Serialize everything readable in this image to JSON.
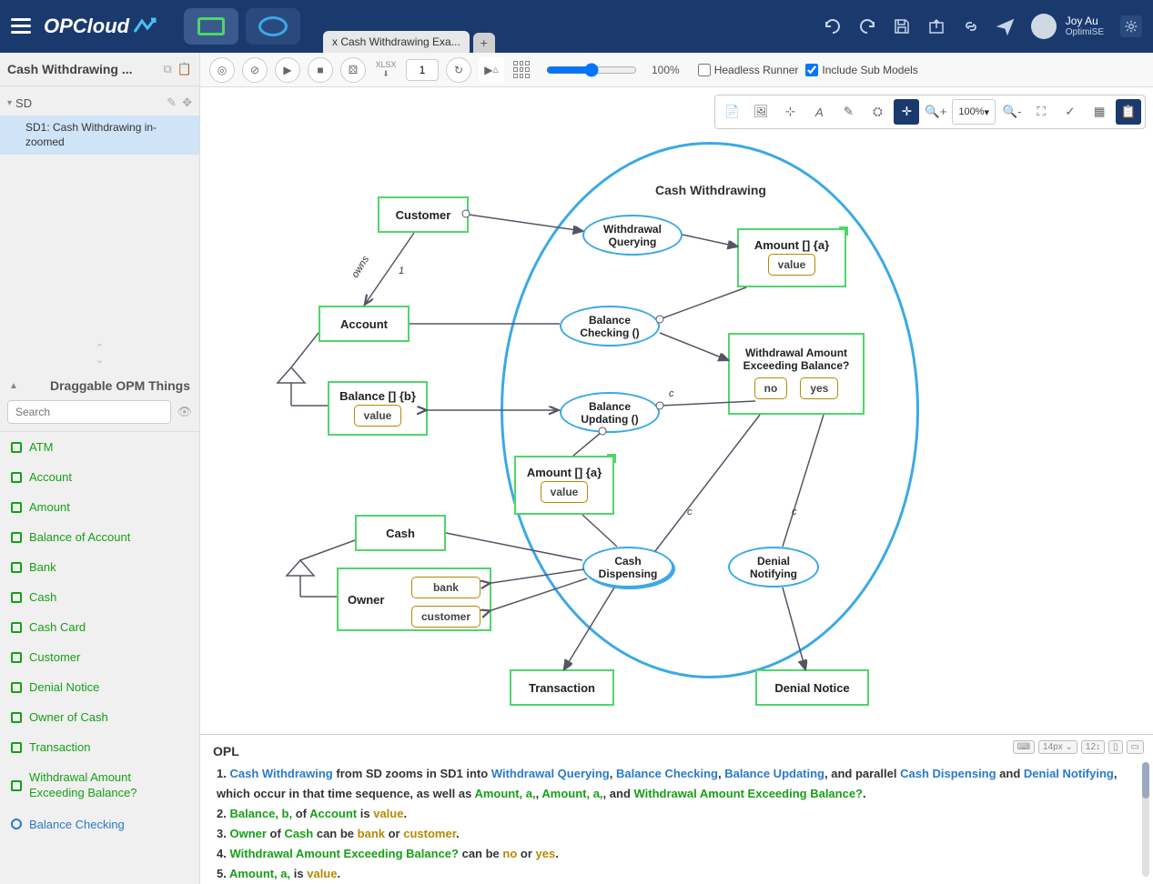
{
  "app": {
    "name": "OPCloud"
  },
  "user": {
    "name": "Joy Au",
    "org": "OptimiSE"
  },
  "shapes": {
    "rect": "object-shape",
    "oval": "process-shape"
  },
  "tab": {
    "label": "x Cash Withdrawing Exa..."
  },
  "toolbar": {
    "xlsx": "XLSX",
    "step": "1",
    "zoom": "100%",
    "headless": "Headless Runner",
    "include": "Include Sub Models"
  },
  "float_toolbar": {
    "zoom": "100%"
  },
  "sidebar": {
    "title": "Cash Withdrawing ...",
    "root": "SD",
    "child": "SD1: Cash Withdrawing in-zoomed",
    "drag_title": "Draggable OPM Things",
    "search_ph": "Search",
    "things": [
      {
        "label": "ATM",
        "type": "obj"
      },
      {
        "label": "Account",
        "type": "obj"
      },
      {
        "label": "Amount",
        "type": "obj"
      },
      {
        "label": "Balance of Account",
        "type": "obj"
      },
      {
        "label": "Bank",
        "type": "obj"
      },
      {
        "label": "Cash",
        "type": "obj"
      },
      {
        "label": "Cash Card",
        "type": "obj"
      },
      {
        "label": "Customer",
        "type": "obj"
      },
      {
        "label": "Denial Notice",
        "type": "obj"
      },
      {
        "label": "Owner of Cash",
        "type": "obj"
      },
      {
        "label": "Transaction",
        "type": "obj"
      },
      {
        "label": "Withdrawal Amount Exceeding Balance?",
        "type": "obj",
        "multiline": true
      },
      {
        "label": "Balance Checking",
        "type": "proc"
      }
    ]
  },
  "diagram": {
    "title": "Cash Withdrawing",
    "customer": "Customer",
    "account": "Account",
    "balance": "Balance [] {b}",
    "balance_val": "value",
    "cash": "Cash",
    "owner": "Owner",
    "owner_bank": "bank",
    "owner_customer": "customer",
    "wquery": "Withdrawal Querying",
    "bcheck": "Balance Checking ()",
    "bupdate": "Balance Updating ()",
    "amount1": "Amount [] {a}",
    "amount1_val": "value",
    "amount2": "Amount [] {a}",
    "amount2_val": "value",
    "exceed": "Withdrawal Amount Exceeding Balance?",
    "no": "no",
    "yes": "yes",
    "cdisp": "Cash Dispensing",
    "dnotify": "Denial Notifying",
    "transaction": "Transaction",
    "denial": "Denial Notice",
    "owns": "owns",
    "one": "1",
    "c": "c"
  },
  "opl": {
    "title": "OPL",
    "fontsize": "14px",
    "l1_a": "1.",
    "l1_cw": "Cash Withdrawing",
    "l1_b": " from SD zooms in SD1 into ",
    "l1_wq": "Withdrawal Querying",
    "l1_bc": "Balance Checking",
    "l1_bu": "Balance Updating",
    "l1_c": ", and parallel ",
    "l1_cd": "Cash Dispensing",
    "l1_and": " and ",
    "l1_dn": "Denial Notifying",
    "l1_d": ", which occur in that time sequence, as well as ",
    "l1_a1": "Amount, a,",
    "l1_a2": "Amount, a,",
    "l1_e": ", and ",
    "l1_waeb": "Withdrawal Amount Exceeding Balance?",
    "l2_a": "2.",
    "l2_bal": "Balance, b,",
    "l2_of": " of ",
    "l2_acc": "Account",
    "l2_is": " is ",
    "l2_val": "value",
    "l3_a": "3.",
    "l3_owner": "Owner",
    "l3_of": " of ",
    "l3_cash": "Cash",
    "l3_can": " can be ",
    "l3_bank": "bank",
    "l3_or": " or ",
    "l3_cust": "customer",
    "l4_a": "4.",
    "l4_waeb": "Withdrawal Amount Exceeding Balance?",
    "l4_can": " can be ",
    "l4_no": "no",
    "l4_or": " or ",
    "l4_yes": "yes",
    "l5_a": "5.",
    "l5_amt": "Amount, a,",
    "l5_is": " is ",
    "l5_val": "value"
  }
}
